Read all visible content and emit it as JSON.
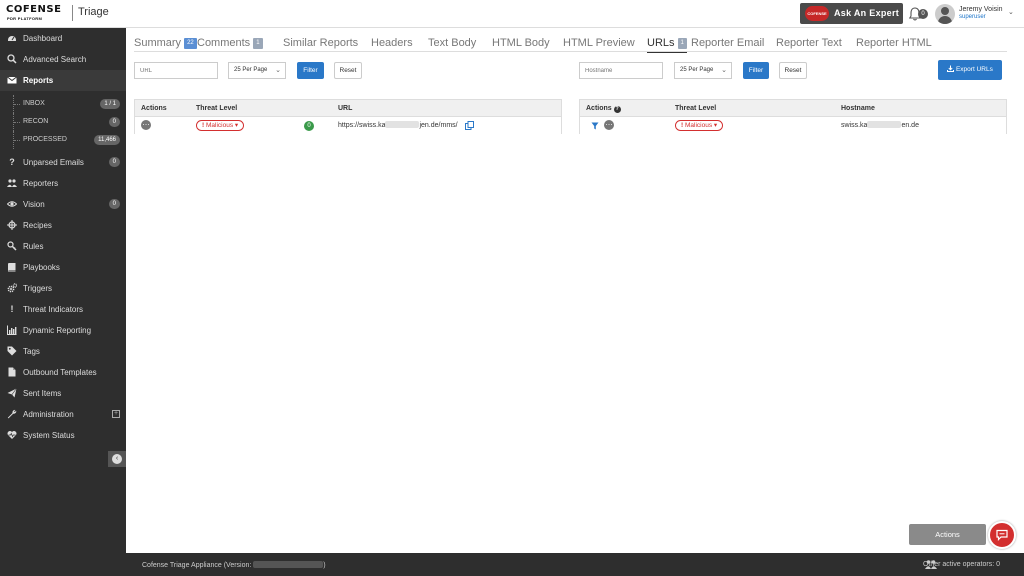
{
  "header": {
    "brand": "COFENSE",
    "brand_sub": "PDR PLATFORM",
    "product": "Triage",
    "expert_badge": "COFENSE",
    "ask_expert": "Ask An Expert",
    "notifications": "0",
    "user_name": "Jeremy Voisin",
    "user_role": "superuser"
  },
  "sidebar": {
    "items": [
      {
        "label": "Dashboard",
        "icon": "dashboard-icon"
      },
      {
        "label": "Advanced Search",
        "icon": "search-icon"
      },
      {
        "label": "Reports",
        "icon": "envelope-icon"
      },
      {
        "label": "Unparsed Emails",
        "icon": "question-icon",
        "count": "0"
      },
      {
        "label": "Reporters",
        "icon": "users-icon"
      },
      {
        "label": "Vision",
        "icon": "eye-icon",
        "count": "0"
      },
      {
        "label": "Recipes",
        "icon": "crosshair-icon"
      },
      {
        "label": "Rules",
        "icon": "rules-icon"
      },
      {
        "label": "Playbooks",
        "icon": "book-icon"
      },
      {
        "label": "Triggers",
        "icon": "cogs-icon"
      },
      {
        "label": "Threat Indicators",
        "icon": "exclamation-icon"
      },
      {
        "label": "Dynamic Reporting",
        "icon": "bar-chart-icon"
      },
      {
        "label": "Tags",
        "icon": "tag-icon"
      },
      {
        "label": "Outbound Templates",
        "icon": "file-icon"
      },
      {
        "label": "Sent Items",
        "icon": "paper-plane-icon"
      },
      {
        "label": "Administration",
        "icon": "wrench-icon"
      },
      {
        "label": "System Status",
        "icon": "heartbeat-icon"
      }
    ],
    "sub_items": [
      {
        "label": "INBOX",
        "count": "1 / 1"
      },
      {
        "label": "RECON",
        "count": "0"
      },
      {
        "label": "PROCESSED",
        "count": "11,466"
      }
    ]
  },
  "tabs": [
    {
      "label": "Summary",
      "count": "22"
    },
    {
      "label": "Comments",
      "count": "1"
    },
    {
      "label": "Similar Reports"
    },
    {
      "label": "Headers"
    },
    {
      "label": "Text Body"
    },
    {
      "label": "HTML Body"
    },
    {
      "label": "HTML Preview"
    },
    {
      "label": "URLs",
      "count": "1"
    },
    {
      "label": "Reporter Email"
    },
    {
      "label": "Reporter Text"
    },
    {
      "label": "Reporter HTML"
    }
  ],
  "url_filter": {
    "placeholder": "URL",
    "per_page": "25 Per Page",
    "filter": "Filter",
    "reset": "Reset"
  },
  "host_filter": {
    "placeholder": "Hostname",
    "per_page": "25 Per Page",
    "filter": "Filter",
    "reset": "Reset",
    "export": "Export URLs"
  },
  "url_table": {
    "headers": [
      "Actions",
      "Threat Level",
      "URL"
    ],
    "row": {
      "threat": "Malicious",
      "score": "0",
      "url_start": "https://swiss.ka",
      "url_end": "jen.de/mms/"
    }
  },
  "host_table": {
    "headers": [
      "Actions",
      "Threat Level",
      "Hostname"
    ],
    "row": {
      "threat": "Malicious",
      "host_start": "swiss.ka",
      "host_end": "en.de"
    }
  },
  "footer": {
    "version": "Cofense Triage Appliance (Version: ",
    "version_end": ")",
    "operators": "Other active operators: 0"
  },
  "actions_button": "Actions",
  "colors": {
    "primary": "#2a78c8",
    "danger": "#d32f2f",
    "sidebar": "#2e2e2e"
  }
}
